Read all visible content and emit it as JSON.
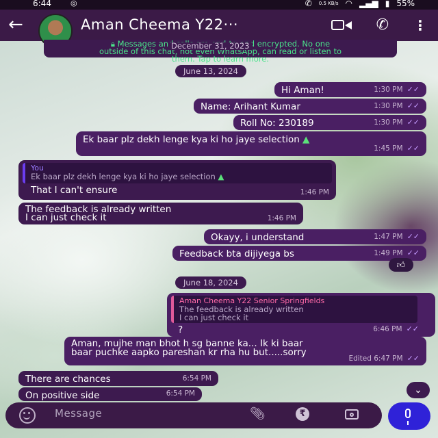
{
  "status": {
    "time": "6:44",
    "speed": "0.5 KB/s",
    "battery": "55%"
  },
  "header": {
    "contact_name": "Aman Cheema Y22···"
  },
  "encryption_notice": {
    "line1": "Messages and calls are end-to-end encrypted. No one",
    "line2": "outside of this chat, not even WhatsApp, can read or listen to",
    "line3": "them. Tap to learn more.",
    "overlay_date": "December 31, 2023"
  },
  "dates": {
    "first": "June 13, 2024",
    "second": "June 18, 2024"
  },
  "messages": {
    "m1": {
      "text": "Hi Aman!",
      "time": "1:30 PM"
    },
    "m2": {
      "text": "Name: Arihant Kumar",
      "time": "1:30 PM"
    },
    "m3": {
      "text": "Roll No: 230189",
      "time": "1:30 PM"
    },
    "m4": {
      "text": "Ek baar plz dekh lenge kya ki ho jaye selection",
      "time": "1:45 PM"
    },
    "m5": {
      "quote_author": "You",
      "quote_text": "Ek baar plz dekh lenge kya ki ho jaye selection",
      "text": "That I can't ensure",
      "time": "1:46 PM"
    },
    "m6": {
      "line1": "The feedback is already written",
      "line2": "I can just check it",
      "time": "1:46 PM"
    },
    "m7": {
      "text": "Okayy, i understand",
      "time": "1:47 PM"
    },
    "m8": {
      "text": "Feedback bta dijiyega bs",
      "time": "1:49 PM"
    },
    "m9": {
      "quote_author": "Aman Cheema Y22 Senior Springfields",
      "quote_line1": "The feedback is already written",
      "quote_line2": "I can just check it",
      "text": "?",
      "time": "6:46 PM"
    },
    "m10": {
      "line1": "Aman, mujhe man bhot h sg banne ka... Ik ki baar",
      "line2": "baar puchke aapko pareshan kr rha hu but.....sorry",
      "edited": "Edited",
      "time": "6:47 PM"
    },
    "m11": {
      "text": "There are chances",
      "time": "6:54 PM"
    },
    "m12": {
      "text": "On positive side",
      "time": "6:54 PM"
    }
  },
  "input": {
    "placeholder": "Message"
  },
  "icons": {
    "reaction": "thumbs-up",
    "send": "mic"
  }
}
